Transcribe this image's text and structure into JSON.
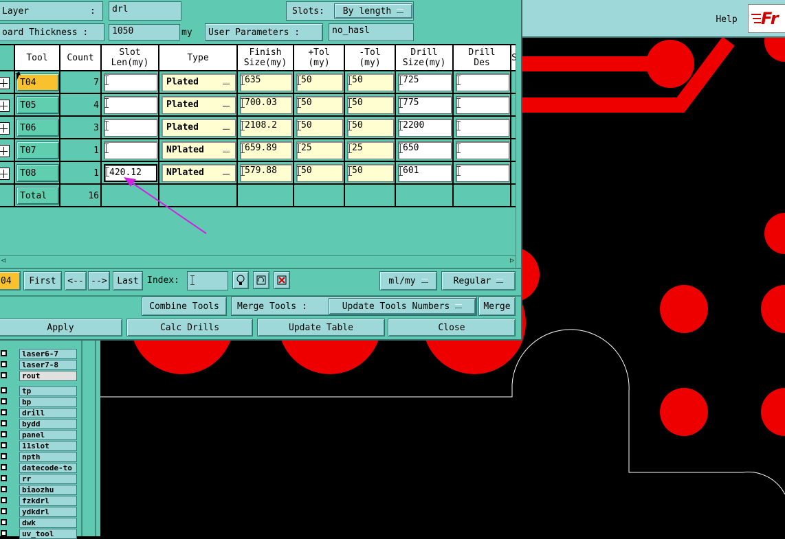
{
  "colors": {
    "panel": "#5fc9b2",
    "field": "#9ed8d8",
    "yellow": "#fffed0",
    "pcb_red": "#ee0000",
    "board_bg": "#000000",
    "accent_arrow": "#d020e0"
  },
  "header": {
    "layer_label": "Layer",
    "layer_colon": ":",
    "layer_value": "drl",
    "slots_label": "Slots:",
    "slots_value": "By length",
    "thickness_label": "oard Thickness :",
    "thickness_value": "1050",
    "thickness_unit": "my",
    "user_params_label": "User Parameters :",
    "user_params_value": "no_hasl"
  },
  "app_bar": {
    "help_label": "Help",
    "logo_text": "Fr"
  },
  "table": {
    "columns": [
      {
        "key": "tool",
        "label": "Tool"
      },
      {
        "key": "count",
        "label": "Count"
      },
      {
        "key": "slot_len",
        "label": "Slot\nLen(my)"
      },
      {
        "key": "type",
        "label": "Type"
      },
      {
        "key": "finish",
        "label": "Finish\nSize(my)"
      },
      {
        "key": "plus_tol",
        "label": "+Tol\n(my)"
      },
      {
        "key": "minus_tol",
        "label": "-Tol\n(my)"
      },
      {
        "key": "drill_size",
        "label": "Drill\nSize(my)"
      },
      {
        "key": "drill_des",
        "label": "Drill\nDes"
      },
      {
        "key": "extra",
        "label": "S"
      }
    ],
    "rows": [
      {
        "tool": "T04",
        "count": "7",
        "slot_len": "",
        "type": "Plated",
        "finish": "635",
        "plus_tol": "50",
        "minus_tol": "50",
        "drill_size": "725",
        "drill_des": "",
        "selected": true
      },
      {
        "tool": "T05",
        "count": "4",
        "slot_len": "",
        "type": "Plated",
        "finish": "700.03",
        "plus_tol": "50",
        "minus_tol": "50",
        "drill_size": "775",
        "drill_des": ""
      },
      {
        "tool": "T06",
        "count": "3",
        "slot_len": "",
        "type": "Plated",
        "finish": "2108.2",
        "plus_tol": "50",
        "minus_tol": "50",
        "drill_size": "2200",
        "drill_des": ""
      },
      {
        "tool": "T07",
        "count": "1",
        "slot_len": "",
        "type": "NPlated",
        "finish": "659.89",
        "plus_tol": "25",
        "minus_tol": "25",
        "drill_size": "650",
        "drill_des": ""
      },
      {
        "tool": "T08",
        "count": "1",
        "slot_len": "420.12",
        "type": "NPlated",
        "finish": "579.88",
        "plus_tol": "50",
        "minus_tol": "50",
        "drill_size": "601",
        "drill_des": ""
      }
    ],
    "total_label": "Total",
    "total_count": "16"
  },
  "nav": {
    "current": "04",
    "first": "First",
    "prev": "<--",
    "next": "-->",
    "last": "Last",
    "index_label": "Index:",
    "index_value": "",
    "units_value": "ml/my",
    "mode_value": "Regular"
  },
  "tools_row": {
    "combine": "Combine Tools",
    "merge_label": "Merge Tools :",
    "merge_select": "Update Tools Numbers",
    "merge_btn": "Merge"
  },
  "actions": {
    "apply": "Apply",
    "calc": "Calc Drills",
    "update": "Update Table",
    "close": "Close"
  },
  "layers_top": [
    "laser6-7",
    "laser7-8",
    "rout"
  ],
  "layers": [
    "tp",
    "bp",
    "drill",
    "bydd",
    "panel",
    "11slot",
    "npth",
    "datecode-to",
    "rr",
    "biaozhu",
    "fzkdrl",
    "ydkdrl",
    "dwk",
    "uv_tool"
  ],
  "icons": [
    "plus-icon",
    "bulb-icon",
    "refresh-icon",
    "delete-icon",
    "dropdown-icon",
    "arrow-pointer-icon",
    "magenta-arrow-icon",
    "logo-icon"
  ]
}
